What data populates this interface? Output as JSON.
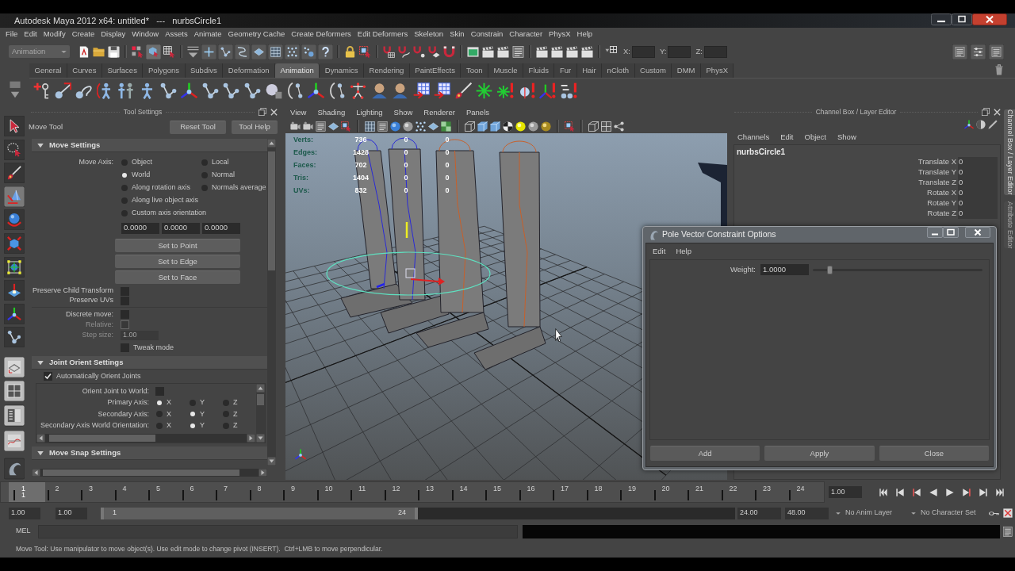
{
  "window": {
    "title": "Autodesk Maya 2012 x64: untitled*   ---   nurbsCircle1"
  },
  "menu_bar": [
    "File",
    "Edit",
    "Modify",
    "Create",
    "Display",
    "Window",
    "Assets",
    "Animate",
    "Geometry Cache",
    "Create Deformers",
    "Edit Deformers",
    "Skeleton",
    "Skin",
    "Constrain",
    "Character",
    "PhysX",
    "Help"
  ],
  "status_line": {
    "menu_set": "Animation",
    "coordinate_fields": [
      {
        "label": "X:"
      },
      {
        "label": "Y:"
      },
      {
        "label": "Z:"
      }
    ]
  },
  "shelf": {
    "tabs": [
      {
        "label": "General",
        "selected": false
      },
      {
        "label": "Curves",
        "selected": false
      },
      {
        "label": "Surfaces",
        "selected": false
      },
      {
        "label": "Polygons",
        "selected": false
      },
      {
        "label": "Subdivs",
        "selected": false
      },
      {
        "label": "Deformation",
        "selected": false
      },
      {
        "label": "Animation",
        "selected": true
      },
      {
        "label": "Dynamics",
        "selected": false
      },
      {
        "label": "Rendering",
        "selected": false
      },
      {
        "label": "PaintEffects",
        "selected": false
      },
      {
        "label": "Toon",
        "selected": false
      },
      {
        "label": "Muscle",
        "selected": false
      },
      {
        "label": "Fluids",
        "selected": false
      },
      {
        "label": "Fur",
        "selected": false
      },
      {
        "label": "Hair",
        "selected": false
      },
      {
        "label": "nCloth",
        "selected": false
      },
      {
        "label": "Custom",
        "selected": false
      },
      {
        "label": "DMM",
        "selected": false
      },
      {
        "label": "PhysX",
        "selected": false
      }
    ]
  },
  "toolbox": {
    "tools": [
      {
        "selected": false
      },
      {
        "selected": false
      },
      {
        "selected": false
      },
      {
        "selected": true
      },
      {
        "selected": false
      },
      {
        "selected": false
      },
      {
        "selected": false
      },
      {
        "selected": false
      },
      {
        "selected": false
      },
      {
        "selected": false
      }
    ]
  },
  "tool_settings": {
    "title": "Tool Settings",
    "tool_name": "Move Tool",
    "buttons": [
      "Reset Tool",
      "Tool Help"
    ],
    "move_settings": {
      "title": "Move Settings",
      "expanded": true,
      "axis_label": "Move Axis:",
      "axis_rows": [
        [
          {
            "label": "Object",
            "selected": false
          },
          {
            "label": "Local",
            "selected": false
          }
        ],
        [
          {
            "label": "World",
            "selected": true
          },
          {
            "label": "Normal",
            "selected": false
          }
        ],
        [
          {
            "label": "Along rotation axis",
            "selected": false
          },
          {
            "label": "Normals average",
            "selected": false
          }
        ],
        [
          {
            "label": "Along live object axis",
            "selected": false
          }
        ],
        [
          {
            "label": "Custom axis orientation",
            "selected": false
          }
        ]
      ],
      "axis_values": [
        "0.0000",
        "0.0000",
        "0.0000"
      ],
      "set_buttons": [
        "Set to Point",
        "Set to Edge",
        "Set to Face"
      ],
      "option_groups": [
        [
          {
            "kind": "checkbox",
            "label": "Preserve Child Transform",
            "checked": false,
            "disabled": false
          },
          {
            "kind": "checkbox",
            "label": "Preserve UVs",
            "checked": false,
            "disabled": false
          }
        ],
        [
          {
            "kind": "checkbox",
            "label": "Discrete move:",
            "checked": false,
            "disabled": false
          },
          {
            "kind": "checkbox",
            "label": "Relative:",
            "checked": false,
            "disabled": true
          },
          {
            "kind": "field",
            "label": "Step size:",
            "value": "1.00",
            "disabled": true
          },
          {
            "kind": "trailing_checkbox",
            "label": "Tweak mode",
            "checked": false,
            "disabled": false
          }
        ]
      ]
    },
    "joint_orient_settings": {
      "title": "Joint Orient Settings",
      "expanded": true,
      "auto_orient": {
        "label": "Automatically Orient Joints",
        "checked": true
      },
      "orient_to_world": {
        "label": "Orient Joint to World:",
        "checked": false
      },
      "axis_rows": [
        {
          "label": "Primary Axis:",
          "options": [
            {
              "label": "X",
              "selected": true
            },
            {
              "label": "Y",
              "selected": false
            },
            {
              "label": "Z",
              "selected": false
            }
          ]
        },
        {
          "label": "Secondary Axis:",
          "options": [
            {
              "label": "X",
              "selected": false
            },
            {
              "label": "Y",
              "selected": true
            },
            {
              "label": "Z",
              "selected": false
            }
          ]
        },
        {
          "label": "Secondary Axis World Orientation:",
          "options": [
            {
              "label": "X",
              "selected": false
            },
            {
              "label": "Y",
              "selected": true
            },
            {
              "label": "Z",
              "selected": false
            }
          ]
        }
      ]
    },
    "move_snap_settings": {
      "title": "Move Snap Settings",
      "expanded": true
    }
  },
  "viewport": {
    "menus": [
      "View",
      "Shading",
      "Lighting",
      "Show",
      "Renderer",
      "Panels"
    ],
    "hud": [
      {
        "label": "Verts:",
        "values": [
          "736",
          "0",
          "0"
        ]
      },
      {
        "label": "Edges:",
        "values": [
          "1428",
          "0",
          "0"
        ]
      },
      {
        "label": "Faces:",
        "values": [
          "702",
          "0",
          "0"
        ]
      },
      {
        "label": "Tris:",
        "values": [
          "1404",
          "0",
          "0"
        ]
      },
      {
        "label": "UVs:",
        "values": [
          "832",
          "0",
          "0"
        ]
      }
    ]
  },
  "channel_box": {
    "title": "Channel Box / Layer Editor",
    "menus": [
      "Channels",
      "Edit",
      "Object",
      "Show"
    ],
    "object_name": "nurbsCircle1",
    "attributes": [
      {
        "name": "Translate X",
        "value": "0"
      },
      {
        "name": "Translate Y",
        "value": "0"
      },
      {
        "name": "Translate Z",
        "value": "0"
      },
      {
        "name": "Rotate X",
        "value": "0"
      },
      {
        "name": "Rotate Y",
        "value": "0"
      },
      {
        "name": "Rotate Z",
        "value": "0"
      }
    ]
  },
  "side_tabs": [
    {
      "label": "Channel Box / Layer Editor",
      "selected": true
    },
    {
      "label": "Attribute Editor",
      "selected": false
    }
  ],
  "dialog": {
    "title": "Pole Vector Constraint Options",
    "menus": [
      "Edit",
      "Help"
    ],
    "weight": {
      "label": "Weight:",
      "value": "1.0000",
      "level": 0.1
    },
    "buttons": [
      "Add",
      "Apply",
      "Close"
    ]
  },
  "time_slider": {
    "frames": [
      {
        "label": "1",
        "selected": true
      },
      {
        "label": "2",
        "selected": false
      },
      {
        "label": "3",
        "selected": false
      },
      {
        "label": "4",
        "selected": false
      },
      {
        "label": "5",
        "selected": false
      },
      {
        "label": "6",
        "selected": false
      },
      {
        "label": "7",
        "selected": false
      },
      {
        "label": "8",
        "selected": false
      },
      {
        "label": "9",
        "selected": false
      },
      {
        "label": "10",
        "selected": false
      },
      {
        "label": "11",
        "selected": false
      },
      {
        "label": "12",
        "selected": false
      },
      {
        "label": "13",
        "selected": false
      },
      {
        "label": "14",
        "selected": false
      },
      {
        "label": "15",
        "selected": false
      },
      {
        "label": "16",
        "selected": false
      },
      {
        "label": "17",
        "selected": false
      },
      {
        "label": "18",
        "selected": false
      },
      {
        "label": "19",
        "selected": false
      },
      {
        "label": "20",
        "selected": false
      },
      {
        "label": "21",
        "selected": false
      },
      {
        "label": "22",
        "selected": false
      },
      {
        "label": "23",
        "selected": false
      },
      {
        "label": "24",
        "selected": false
      }
    ],
    "current_frame": "1",
    "current_time": "1.00"
  },
  "range_slider": {
    "start_time": "1.00",
    "range_start": "1.00",
    "range_start_label": "1",
    "range_end_label": "24",
    "level": 0.5,
    "range_end": "24.00",
    "end_time": "48.00",
    "anim_layer": "No Anim Layer",
    "character_set": "No Character Set"
  },
  "command_line": {
    "language": "MEL"
  },
  "help_line": "Move Tool: Use manipulator to move object(s). Use edit mode to change pivot (INSERT).  Ctrl+LMB to move perpendicular."
}
